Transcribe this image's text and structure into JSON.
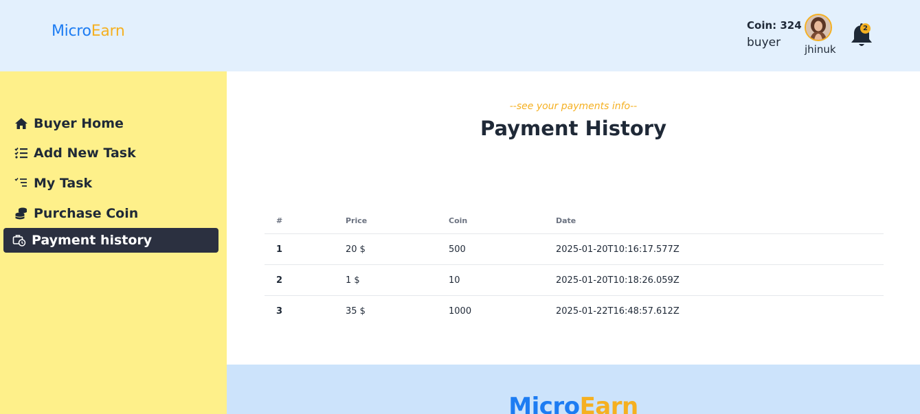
{
  "brand": {
    "part1": "Micro",
    "part2": "Earn"
  },
  "header": {
    "coin_label": "Coin: 324",
    "role": "buyer",
    "username": "jhinuk",
    "notification_count": "2"
  },
  "sidebar": {
    "items": [
      {
        "label": "Buyer Home",
        "icon": "home-icon"
      },
      {
        "label": "Add New Task",
        "icon": "checklist-icon"
      },
      {
        "label": "My Task",
        "icon": "task-list-icon"
      },
      {
        "label": "Purchase Coin",
        "icon": "coins-icon"
      },
      {
        "label": "Payment history",
        "icon": "briefcase-clock-icon",
        "active": true
      }
    ]
  },
  "main": {
    "subtitle": "--see your payments info--",
    "title": "Payment History"
  },
  "table": {
    "headers": [
      "#",
      "Price",
      "Coin",
      "Date"
    ],
    "rows": [
      [
        "1",
        "20 $",
        "500",
        "2025-01-20T10:16:17.577Z"
      ],
      [
        "2",
        "1 $",
        "10",
        "2025-01-20T10:18:26.059Z"
      ],
      [
        "3",
        "35 $",
        "1000",
        "2025-01-22T16:48:57.612Z"
      ]
    ]
  },
  "colors": {
    "header_bg": "#e3f0fd",
    "sidebar_bg": "#fef08a",
    "active_item_bg": "#2b3040",
    "accent_blue": "#1d7cf2",
    "accent_yellow": "#f5b021",
    "footer_bg": "#cce3fb"
  }
}
